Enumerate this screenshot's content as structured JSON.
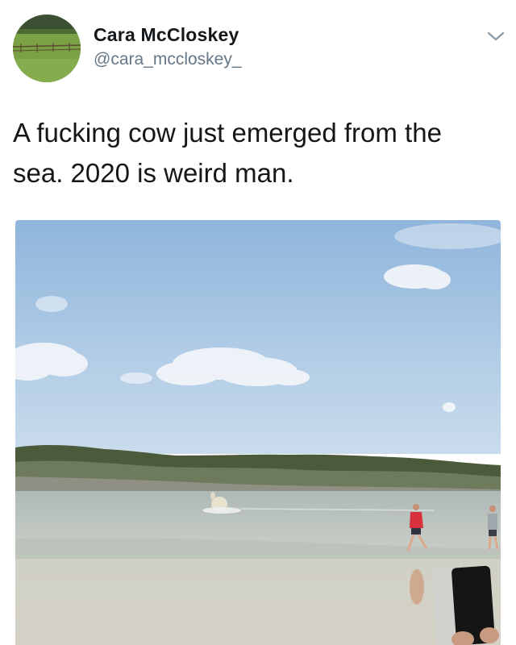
{
  "user": {
    "display_name": "Cara McCloskey",
    "handle": "@cara_mccloskey_"
  },
  "tweet": {
    "text_line_1": "A fucking cow just emerged from the",
    "text_line_2": "sea. 2020 is weird man."
  },
  "icons": {
    "menu": "chevron-down-icon"
  },
  "colors": {
    "name": "#14171a",
    "handle": "#657786",
    "sky": "#a8c6e3",
    "sea": "#c9cfc7"
  }
}
